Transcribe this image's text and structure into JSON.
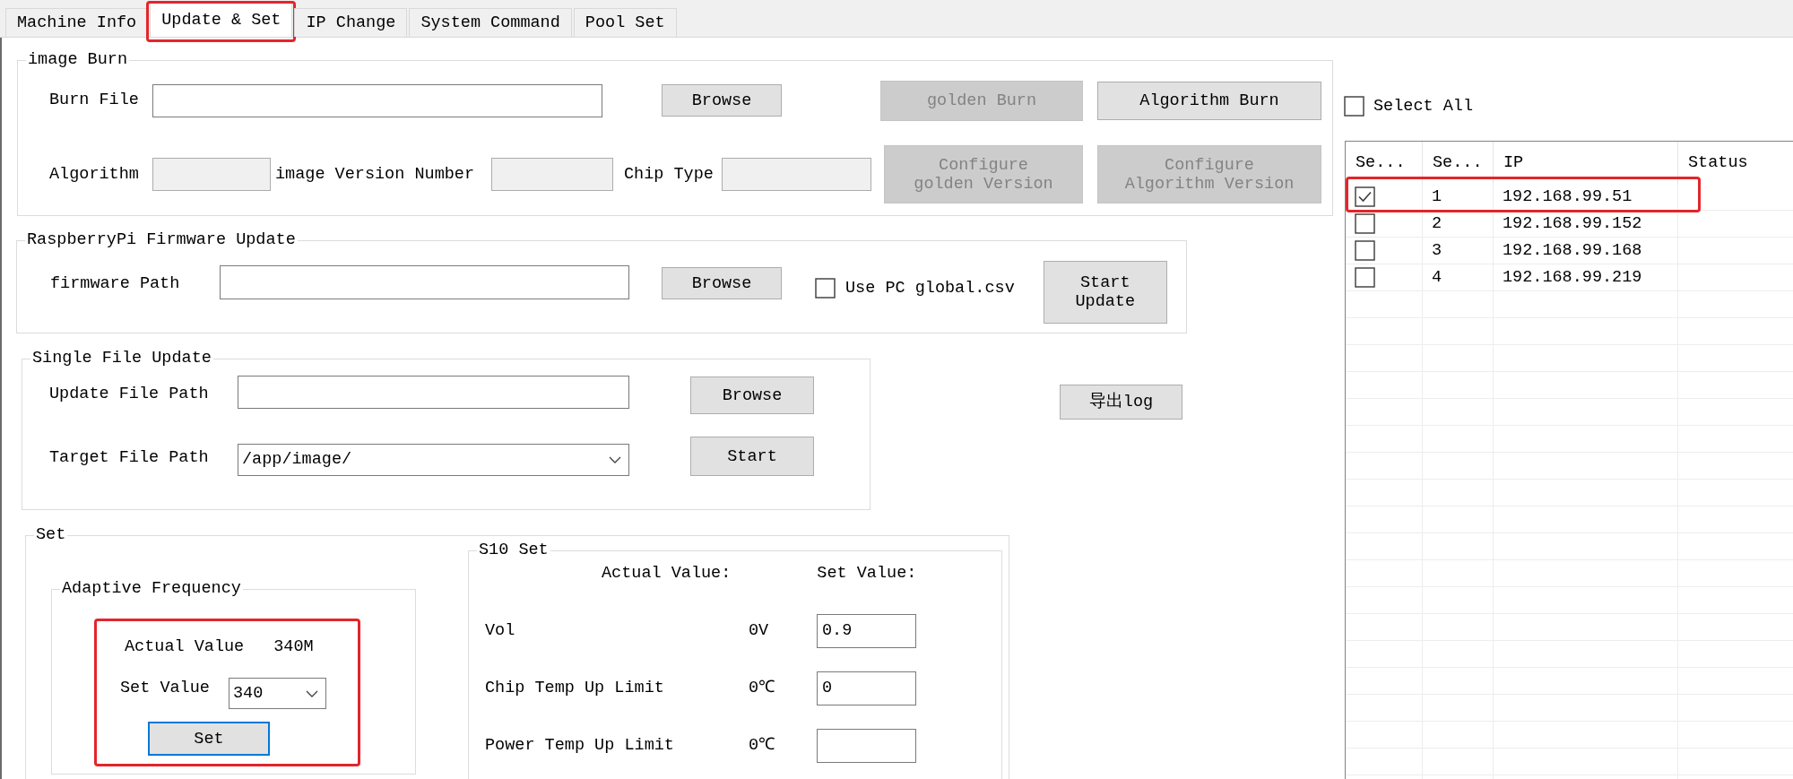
{
  "tabs": [
    {
      "label": "Machine Info",
      "selected": false,
      "highlighted": false
    },
    {
      "label": "Update & Set",
      "selected": true,
      "highlighted": true
    },
    {
      "label": "IP Change",
      "selected": false,
      "highlighted": false
    },
    {
      "label": "System Command",
      "selected": false,
      "highlighted": false
    },
    {
      "label": "Pool Set",
      "selected": false,
      "highlighted": false
    }
  ],
  "image_burn": {
    "title": "image Burn",
    "burn_file": {
      "label": "Burn File"
    },
    "browse_button": "Browse",
    "fields": [
      {
        "label": "Algorithm",
        "disabled": true
      },
      {
        "label": "image Version Number",
        "disabled": true
      },
      {
        "label": "Chip Type",
        "disabled": true
      }
    ],
    "buttons": [
      {
        "label": "golden Burn",
        "disabled": true
      },
      {
        "label": "Algorithm Burn",
        "disabled": false
      },
      {
        "label": "Configure golden Version",
        "disabled": true
      },
      {
        "label": "Configure Algorithm Version",
        "disabled": true
      }
    ]
  },
  "firmware_update": {
    "title": "RaspberryPi Firmware Update",
    "path_label": "firmware Path",
    "browse_button": "Browse",
    "use_pc_csv": {
      "label": "Use PC global.csv",
      "checked": false
    },
    "start_button": "Start Update"
  },
  "single_file_update": {
    "title": "Single File Update",
    "update_path_label": "Update File Path",
    "browse_button": "Browse",
    "target_path": {
      "label": "Target File Path",
      "value": "/app/image/"
    },
    "start_button": "Start"
  },
  "export_log_button": "导出log",
  "set_group": {
    "title": "Set",
    "adaptive_frequency": {
      "title": "Adaptive Frequency",
      "highlighted": true,
      "actual_label": "Actual Value",
      "actual_value": "340M",
      "set_label": "Set Value",
      "set_value": "340",
      "set_button": {
        "label": "Set",
        "focused": true
      }
    },
    "s10_set": {
      "title": "S10 Set",
      "actual_header": "Actual Value:",
      "set_header": "Set Value:",
      "rows": [
        {
          "label": "Vol",
          "actual": "0V",
          "value": "0.9"
        },
        {
          "label": "Chip Temp Up Limit",
          "actual": "0℃",
          "value": "0"
        },
        {
          "label": "Power Temp Up Limit",
          "actual": "0℃"
        }
      ]
    }
  },
  "devices": {
    "select_all": {
      "label": "Select All",
      "checked": false
    },
    "columns": [
      "Se...",
      "Se...",
      "IP",
      "Status"
    ],
    "rows": [
      {
        "checked": true,
        "highlighted": true,
        "index": "1",
        "ip": "192.168.99.51"
      },
      {
        "checked": false,
        "highlighted": false,
        "index": "2",
        "ip": "192.168.99.152"
      },
      {
        "checked": false,
        "highlighted": false,
        "index": "3",
        "ip": "192.168.99.168"
      },
      {
        "checked": false,
        "highlighted": false,
        "index": "4",
        "ip": "192.168.99.219"
      }
    ]
  }
}
